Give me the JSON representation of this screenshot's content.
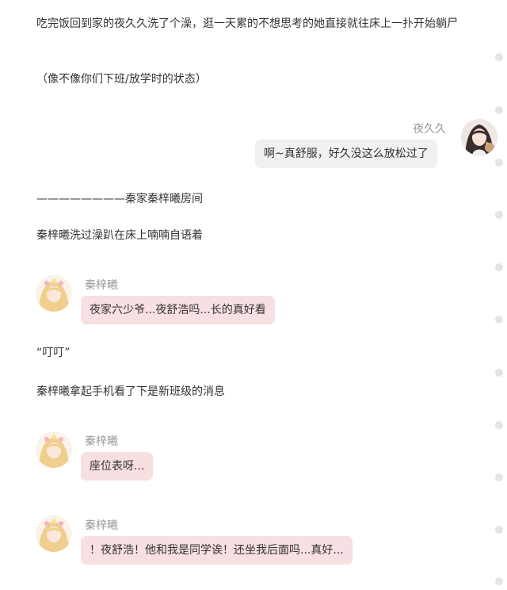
{
  "story": {
    "narration": [
      "吃完饭回到家的夜久久洗了个澡，逛一天累的不想思考的她直接就往床上一扑开始躺尸",
      "（像不像你们下班/放学时的状态）",
      "————————秦家秦梓曦房间",
      "秦梓曦洗过澡趴在床上喃喃自语着",
      "“叮叮”",
      "秦梓曦拿起手机看了下是新班级的消息"
    ],
    "messages": [
      {
        "speaker": "夜久久",
        "text": "啊~真舒服，好久没这么放松过了"
      },
      {
        "speaker": "秦梓曦",
        "text": "夜家六少爷...夜舒浩吗...长的真好看"
      },
      {
        "speaker": "秦梓曦",
        "text": "座位表呀..."
      },
      {
        "speaker": "秦梓曦",
        "text": "！夜舒浩！他和我是同学诶！还坐我后面吗...真好..."
      }
    ]
  },
  "colors": {
    "bubble_pink": "#f8dfe1",
    "bubble_gray": "#f1f1f1",
    "speaker_name": "#999999",
    "text": "#333333"
  }
}
